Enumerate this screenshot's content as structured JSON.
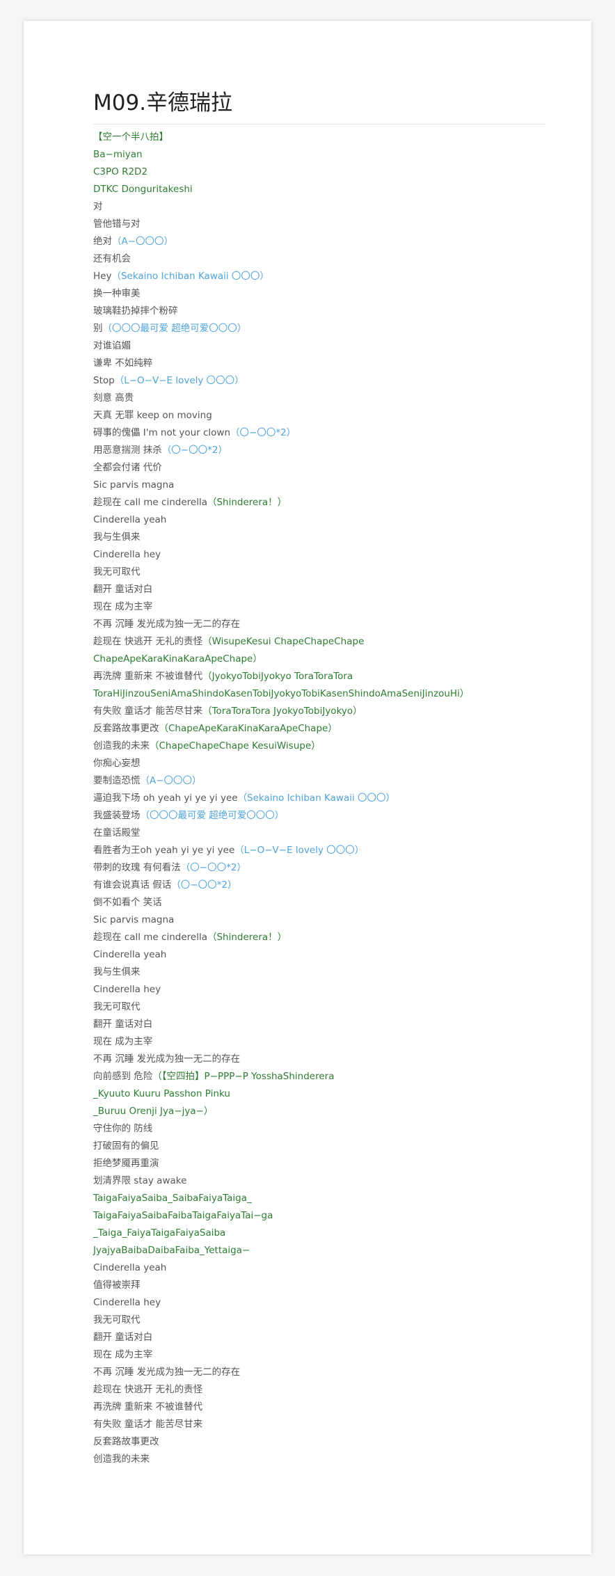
{
  "colors": {
    "normal": "#555555",
    "green": "#2e7d32",
    "blue": "#4fa3d9"
  },
  "title": "M09.辛德瑞拉",
  "lines": [
    [
      {
        "t": "【空一个半八拍】",
        "c": "g"
      }
    ],
    [
      {
        "t": "Ba−miyan",
        "c": "g"
      }
    ],
    [
      {
        "t": "C3PO R2D2",
        "c": "g"
      }
    ],
    [
      {
        "t": "DTKC Donguritakeshi",
        "c": "g"
      }
    ],
    [
      {
        "t": "对",
        "c": "n"
      }
    ],
    [
      {
        "t": "管他错与对",
        "c": "n"
      }
    ],
    [
      {
        "t": "绝对",
        "c": "n"
      },
      {
        "t": "（A−〇〇〇）",
        "c": "b"
      }
    ],
    [
      {
        "t": "还有机会",
        "c": "n"
      }
    ],
    [
      {
        "t": "Hey",
        "c": "n"
      },
      {
        "t": "（Sekaino Ichiban Kawaii 〇〇〇）",
        "c": "b"
      }
    ],
    [
      {
        "t": "换一种审美",
        "c": "n"
      }
    ],
    [
      {
        "t": "玻璃鞋扔掉摔个粉碎",
        "c": "n"
      }
    ],
    [
      {
        "t": "别",
        "c": "n"
      },
      {
        "t": "（〇〇〇最可爱   超绝可爱〇〇〇）",
        "c": "b"
      }
    ],
    [
      {
        "t": "对谁谄媚",
        "c": "n"
      }
    ],
    [
      {
        "t": "谦卑 不如纯粹",
        "c": "n"
      }
    ],
    [
      {
        "t": "Stop",
        "c": "n"
      },
      {
        "t": "（L−O−V−E lovely 〇〇〇）",
        "c": "b"
      }
    ],
    [
      {
        "t": "刻意 高贵",
        "c": "n"
      }
    ],
    [
      {
        "t": "天真 无罪 keep on moving",
        "c": "n"
      }
    ],
    [
      {
        "t": "碍事的傀儡 I'm not your clown",
        "c": "n"
      },
      {
        "t": "（〇−〇〇*2）",
        "c": "b"
      }
    ],
    [
      {
        "t": "用恶意揣测 抹杀",
        "c": "n"
      },
      {
        "t": "（〇−〇〇*2）",
        "c": "b"
      }
    ],
    [
      {
        "t": "全都会付诸 代价",
        "c": "n"
      }
    ],
    [
      {
        "t": "Sic parvis magna",
        "c": "n"
      }
    ],
    [
      {
        "t": "趁现在 call me cinderella",
        "c": "n"
      },
      {
        "t": "（Shinderera！）",
        "c": "g"
      }
    ],
    [
      {
        "t": "Cinderella yeah",
        "c": "n"
      }
    ],
    [
      {
        "t": "我与生俱来",
        "c": "n"
      }
    ],
    [
      {
        "t": "Cinderella hey",
        "c": "n"
      }
    ],
    [
      {
        "t": "我无可取代",
        "c": "n"
      }
    ],
    [
      {
        "t": "翻开 童话对白",
        "c": "n"
      }
    ],
    [
      {
        "t": "现在 成为主宰",
        "c": "n"
      }
    ],
    [
      {
        "t": "不再 沉睡 发光成为独一无二的存在",
        "c": "n"
      }
    ],
    [
      {
        "t": "趁现在 快逃开 无礼的责怪",
        "c": "n"
      },
      {
        "t": "（WisupeKesui ChapeChapeChape",
        "c": "g"
      }
    ],
    [
      {
        "t": "ChapeApeKaraKinaKaraApeChape）",
        "c": "g"
      }
    ],
    [
      {
        "t": "再洗牌 重新来 不被谁替代",
        "c": "n"
      },
      {
        "t": "（JyokyoTobiJyokyo ToraToraTora",
        "c": "g"
      }
    ],
    [
      {
        "t": "ToraHiJinzouSeniAmaShindoKasenTobiJyokyoTobiKasenShindoAmaSeniJinzouHi）",
        "c": "g"
      }
    ],
    [
      {
        "t": "有失败 童话才 能苦尽甘来",
        "c": "n"
      },
      {
        "t": "（ToraToraTora JyokyoTobiJyokyo）",
        "c": "g"
      }
    ],
    [
      {
        "t": "反套路故事更改",
        "c": "n"
      },
      {
        "t": "（ChapeApeKaraKinaKaraApeChape）",
        "c": "g"
      }
    ],
    [
      {
        "t": "创造我的未来",
        "c": "n"
      },
      {
        "t": "（ChapeChapeChape KesuiWisupe）",
        "c": "g"
      }
    ],
    [
      {
        "t": "你痴心妄想",
        "c": "n"
      }
    ],
    [
      {
        "t": "要制造恐慌",
        "c": "n"
      },
      {
        "t": "（A−〇〇〇）",
        "c": "b"
      }
    ],
    [
      {
        "t": "逼迫我下场 oh yeah yi ye yi yee",
        "c": "n"
      },
      {
        "t": "（Sekaino Ichiban Kawaii 〇〇〇）",
        "c": "b"
      }
    ],
    [
      {
        "t": "我盛装登场",
        "c": "n"
      },
      {
        "t": "（〇〇〇最可爱   超绝可爱〇〇〇）",
        "c": "b"
      }
    ],
    [
      {
        "t": "在童话殿堂",
        "c": "n"
      }
    ],
    [
      {
        "t": "看胜者为王oh yeah yi ye yi yee",
        "c": "n"
      },
      {
        "t": "（L−O−V−E lovely 〇〇〇）",
        "c": "b"
      }
    ],
    [
      {
        "t": "带刺的玫瑰 有何看法",
        "c": "n"
      },
      {
        "t": "（〇−〇〇*2）",
        "c": "b"
      }
    ],
    [
      {
        "t": "有谁会说真话 假话",
        "c": "n"
      },
      {
        "t": "（〇−〇〇*2）",
        "c": "b"
      }
    ],
    [
      {
        "t": "倒不如看个 笑话",
        "c": "n"
      }
    ],
    [
      {
        "t": "Sic parvis magna",
        "c": "n"
      }
    ],
    [
      {
        "t": "趁现在 call me cinderella",
        "c": "n"
      },
      {
        "t": "（Shinderera！）",
        "c": "g"
      }
    ],
    [
      {
        "t": "Cinderella yeah",
        "c": "n"
      }
    ],
    [
      {
        "t": "我与生俱来",
        "c": "n"
      }
    ],
    [
      {
        "t": "Cinderella hey",
        "c": "n"
      }
    ],
    [
      {
        "t": "我无可取代",
        "c": "n"
      }
    ],
    [
      {
        "t": "翻开 童话对白",
        "c": "n"
      }
    ],
    [
      {
        "t": "现在 成为主宰",
        "c": "n"
      }
    ],
    [
      {
        "t": "不再 沉睡 发光成为独一无二的存在",
        "c": "n"
      }
    ],
    [
      {
        "t": "向前感到 危险",
        "c": "n"
      },
      {
        "t": "（【空四拍】P−PPP−P YosshaShinderera",
        "c": "g"
      }
    ],
    [
      {
        "t": "_Kyuuto Kuuru Passhon Pinku",
        "c": "g"
      }
    ],
    [
      {
        "t": "_Buruu Orenji Jya−jya−）",
        "c": "g"
      }
    ],
    [
      {
        "t": "守住你的 防线",
        "c": "n"
      }
    ],
    [
      {
        "t": "打破固有的偏见",
        "c": "n"
      }
    ],
    [
      {
        "t": "拒绝梦魇再重演",
        "c": "n"
      }
    ],
    [
      {
        "t": "划清界限 stay awake",
        "c": "n"
      }
    ],
    [
      {
        "t": "TaigaFaiyaSaiba_SaibaFaiyaTaiga_",
        "c": "g"
      }
    ],
    [
      {
        "t": "TaigaFaiyaSaibaFaibaTaigaFaiyaTai−ga",
        "c": "g"
      }
    ],
    [
      {
        "t": "_Taiga_FaiyaTaigaFaiyaSaiba",
        "c": "g"
      }
    ],
    [
      {
        "t": "JyajyaBaibaDaibaFaiba_Yettaiga−",
        "c": "g"
      }
    ],
    [
      {
        "t": "Cinderella yeah",
        "c": "n"
      }
    ],
    [
      {
        "t": "值得被崇拜",
        "c": "n"
      }
    ],
    [
      {
        "t": "Cinderella hey",
        "c": "n"
      }
    ],
    [
      {
        "t": "我无可取代",
        "c": "n"
      }
    ],
    [
      {
        "t": "翻开 童话对白",
        "c": "n"
      }
    ],
    [
      {
        "t": "现在 成为主宰",
        "c": "n"
      }
    ],
    [
      {
        "t": "不再 沉睡 发光成为独一无二的存在",
        "c": "n"
      }
    ],
    [
      {
        "t": "趁现在 快逃开 无礼的责怪",
        "c": "n"
      }
    ],
    [
      {
        "t": "再洗牌 重新来 不被谁替代",
        "c": "n"
      }
    ],
    [
      {
        "t": "有失败 童话才 能苦尽甘来",
        "c": "n"
      }
    ],
    [
      {
        "t": "反套路故事更改",
        "c": "n"
      }
    ],
    [
      {
        "t": "创造我的未来",
        "c": "n"
      }
    ]
  ]
}
